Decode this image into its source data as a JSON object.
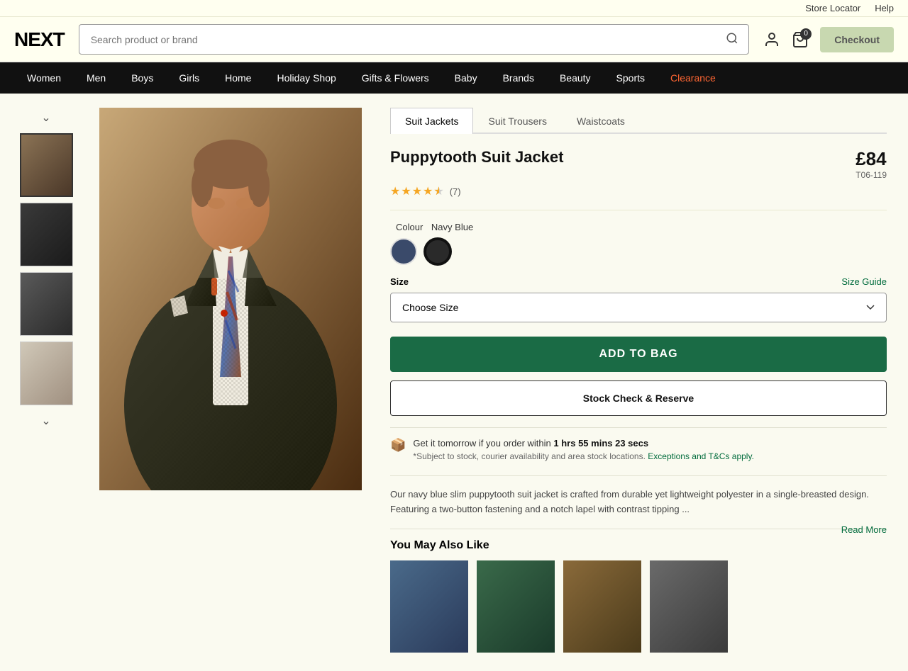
{
  "utility": {
    "store_locator": "Store Locator",
    "help": "Help"
  },
  "header": {
    "logo": "NEXT",
    "search_placeholder": "Search product or brand",
    "cart_count": "0",
    "checkout_label": "Checkout"
  },
  "nav": {
    "items": [
      {
        "label": "Women",
        "id": "women"
      },
      {
        "label": "Men",
        "id": "men"
      },
      {
        "label": "Boys",
        "id": "boys"
      },
      {
        "label": "Girls",
        "id": "girls"
      },
      {
        "label": "Home",
        "id": "home"
      },
      {
        "label": "Holiday Shop",
        "id": "holiday"
      },
      {
        "label": "Gifts & Flowers",
        "id": "gifts"
      },
      {
        "label": "Baby",
        "id": "baby"
      },
      {
        "label": "Brands",
        "id": "brands"
      },
      {
        "label": "Beauty",
        "id": "beauty"
      },
      {
        "label": "Sports",
        "id": "sports"
      },
      {
        "label": "Clearance",
        "id": "clearance"
      }
    ]
  },
  "product": {
    "tabs": [
      {
        "label": "Suit Jackets",
        "active": true
      },
      {
        "label": "Suit Trousers",
        "active": false
      },
      {
        "label": "Waistcoats",
        "active": false
      }
    ],
    "title": "Puppytooth Suit Jacket",
    "price": "£84",
    "code": "T06-119",
    "rating": 4.5,
    "review_count": "(7)",
    "colour_label": "Colour",
    "colour_value": "Navy Blue",
    "colours": [
      {
        "name": "navy",
        "label": "Navy Blue"
      },
      {
        "name": "dark",
        "label": "Dark",
        "selected": true
      }
    ],
    "size_label": "Size",
    "size_guide": "Size Guide",
    "size_placeholder": "Choose Size",
    "add_to_bag": "ADD TO BAG",
    "stock_reserve": "Stock Check & Reserve",
    "delivery_icon": "📦",
    "delivery_text": "Get it tomorrow if you order within ",
    "delivery_time": "1 hrs 55 mins 23 secs",
    "delivery_sub": "*Subject to stock, courier availability and area stock locations. ",
    "delivery_sub_link": "Exceptions and T&Cs apply.",
    "description": "Our navy blue slim puppytooth suit jacket is crafted from durable yet lightweight polyester in a single-breasted design. Featuring a two-button fastening and a notch lapel with contrast tipping ...",
    "read_more": "Read More",
    "you_may_like": "You May Also Like"
  }
}
